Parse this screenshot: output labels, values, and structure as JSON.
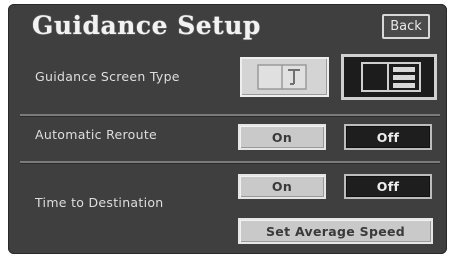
{
  "header": {
    "title": "Guidance Setup",
    "back_label": "Back"
  },
  "rows": {
    "guidance_screen_type": {
      "label": "Guidance Screen Type",
      "options": [
        {
          "icon": "split-map-icon",
          "selected": true
        },
        {
          "icon": "full-list-icon",
          "selected": false
        }
      ]
    },
    "automatic_reroute": {
      "label": "Automatic Reroute",
      "on_label": "On",
      "off_label": "Off",
      "selected": "On"
    },
    "time_to_destination": {
      "label": "Time to Destination",
      "on_label": "On",
      "off_label": "Off",
      "selected": "On",
      "set_speed_label": "Set Average Speed"
    }
  },
  "colors": {
    "screen_bg": "#3f3f3f",
    "selected_bg": "#c9c9c9",
    "unselected_bg": "#1e1e1e",
    "text": "#dedede"
  }
}
